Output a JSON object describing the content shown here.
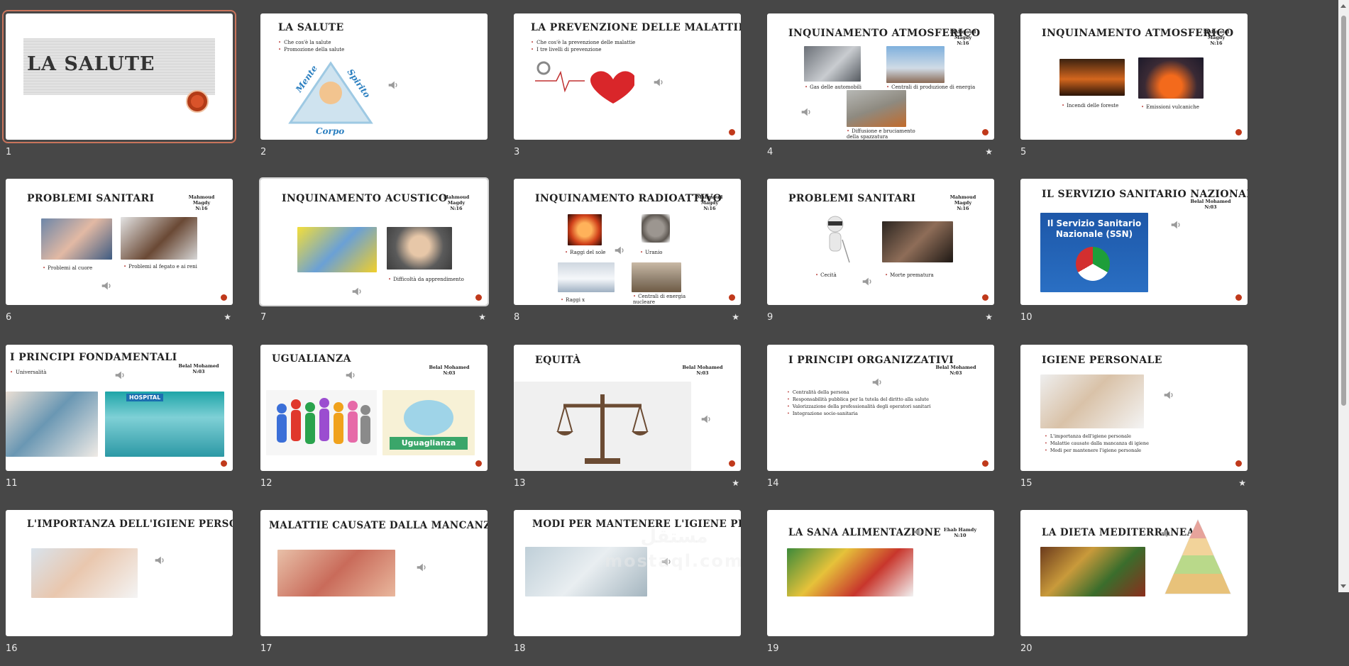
{
  "slides": [
    {
      "number": "1",
      "title": "LA SALUTE",
      "starred": false,
      "selected": true
    },
    {
      "number": "2",
      "title": "LA SALUTE",
      "bullets": [
        "Che cos'è la salute",
        "Promozione della salute"
      ],
      "triangle": [
        "Mente",
        "Spirito",
        "Corpo"
      ],
      "starred": false
    },
    {
      "number": "3",
      "title": "LA PREVENZIONE DELLE MALATTIE",
      "bullets": [
        "Che cos'è la prevenzione delle malattie",
        "I tre livelli di prevenzione"
      ],
      "starred": false
    },
    {
      "number": "4",
      "title": "INQUINAMENTO ATMOSFERICO",
      "author": [
        "Mahmoud Magdy",
        "N:16"
      ],
      "captions": [
        "Gas delle automobili",
        "Centrali di produzione di energia",
        "Diffusione e bruciamento della spazzatura"
      ],
      "starred": true
    },
    {
      "number": "5",
      "title": "INQUINAMENTO ATMOSFERICO",
      "author": [
        "Mahmoud Magdy",
        "N:16"
      ],
      "captions": [
        "Incendi delle foreste",
        "Emissioni vulcaniche"
      ],
      "starred": false
    },
    {
      "number": "6",
      "title": "PROBLEMI SANITARI",
      "author": [
        "Mahmoud Magdy",
        "N:16"
      ],
      "captions": [
        "Problemi al cuore",
        "Problemi al fegato e ai reni"
      ],
      "starred": true
    },
    {
      "number": "7",
      "title": "INQUINAMENTO ACUSTICO",
      "author": [
        "Mahmoud Magdy",
        "N:16"
      ],
      "captions": [
        "Difficoltà da apprendimento"
      ],
      "starred": true
    },
    {
      "number": "8",
      "title": "INQUINAMENTO RADIOATTIVO",
      "author": [
        "Mahmoud Magdy",
        "N:16"
      ],
      "captions": [
        "Raggi del sole",
        "Uranio",
        "Raggi x",
        "Centrali di energia nucleare"
      ],
      "starred": true
    },
    {
      "number": "9",
      "title": "PROBLEMI SANITARI",
      "author": [
        "Mahmoud Magdy",
        "N:16"
      ],
      "captions": [
        "Cecità",
        "Morte prematura"
      ],
      "starred": true
    },
    {
      "number": "10",
      "title": "IL SERVIZIO SANITARIO NAZIONALE",
      "author": [
        "Belal Mohamed",
        "N:03"
      ],
      "ssn": "Il Servizio Sanitario Nazionale (SSN)",
      "starred": false
    },
    {
      "number": "11",
      "title": "I PRINCIPI FONDAMENTALI",
      "author": [
        "Belal Mohamed",
        "N:03"
      ],
      "bullets": [
        "Universalità"
      ],
      "hospital": "HOSPITAL",
      "starred": false
    },
    {
      "number": "12",
      "title": "UGUALIANZA",
      "author": [
        "Belal Mohamed",
        "N:03"
      ],
      "banner": "Uguaglianza",
      "starred": false
    },
    {
      "number": "13",
      "title": "EQUITÀ",
      "author": [
        "Belal Mohamed",
        "N:03"
      ],
      "starred": true
    },
    {
      "number": "14",
      "title": "I PRINCIPI ORGANIZZATIVI",
      "author": [
        "Belal Mohamed",
        "N:03"
      ],
      "bullets": [
        "Centralità della persona",
        "Responsabilità pubblica per la tutela del diritto alla salute",
        "Valorizzazione della professionalità degli operatori sanitari",
        "Integrazione socio-sanitaria"
      ],
      "starred": false
    },
    {
      "number": "15",
      "title": "IGIENE PERSONALE",
      "bullets": [
        "L'importanza dell'igiene personale",
        "Malattie causate dalla mancanza di igiene",
        "Modi per mantenere l'igiene personale"
      ],
      "starred": true
    },
    {
      "number": "16",
      "title": "L'IMPORTANZA DELL'IGIENE PERSONALE"
    },
    {
      "number": "17",
      "title": "MALATTIE CAUSATE DALLA MANCANZA DI IGIENE"
    },
    {
      "number": "18",
      "title": "MODI PER MANTENERE L'IGIENE PERSONALE"
    },
    {
      "number": "19",
      "title": "LA SANA ALIMENTAZIONE",
      "author": [
        "Ehab Hamdy",
        "N:10"
      ]
    },
    {
      "number": "20",
      "title": "LA DIETA MEDITERRANEA"
    }
  ],
  "watermark": {
    "main": "مستقل",
    "sub": "mostaql.com"
  },
  "colors": {
    "background": "#474747",
    "accent": "#c0504d",
    "selection": "#c9745c"
  },
  "icons": {
    "audio": "speaker-icon",
    "record": "record-dot-icon",
    "animation": "star-icon"
  },
  "star_glyph": "★"
}
